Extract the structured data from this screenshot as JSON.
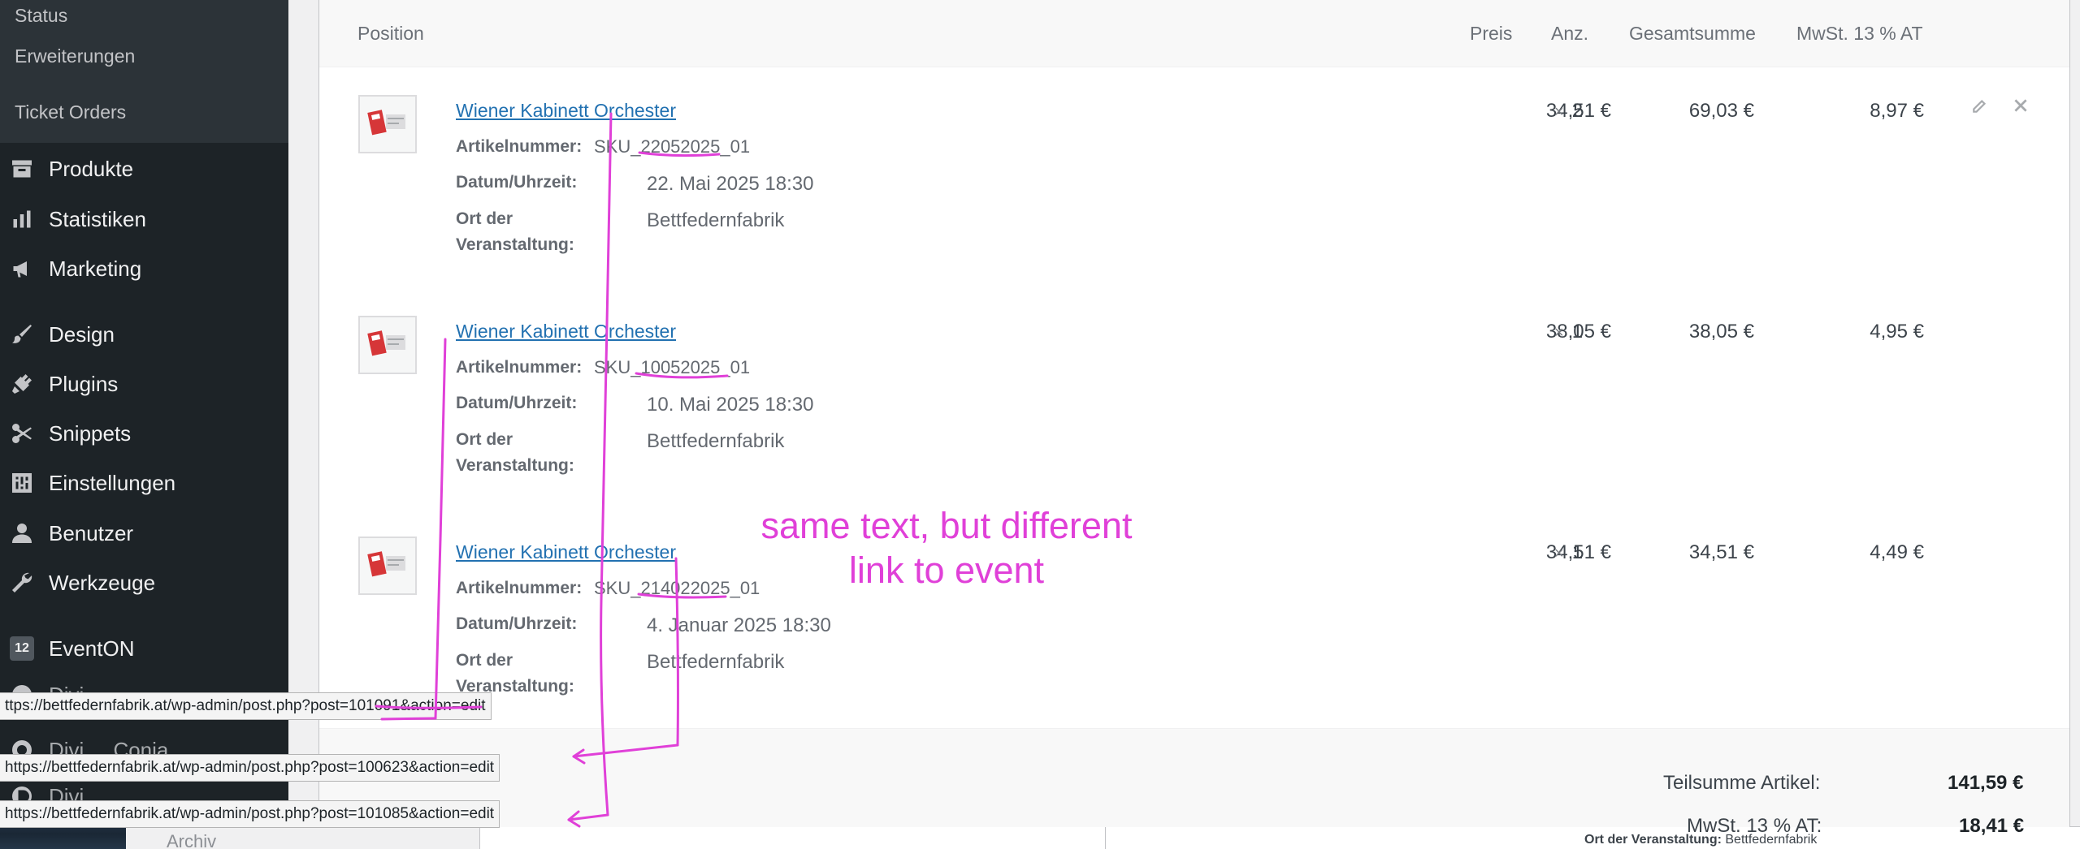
{
  "sidebar": {
    "sub_items": [
      "Status",
      "Erweiterungen",
      "Ticket Orders"
    ],
    "items": [
      {
        "label": "Produkte",
        "icon": "archive-icon"
      },
      {
        "label": "Statistiken",
        "icon": "bar-chart-icon"
      },
      {
        "label": "Marketing",
        "icon": "megaphone-icon"
      },
      {
        "label": "Design",
        "icon": "paintbrush-icon"
      },
      {
        "label": "Plugins",
        "icon": "plug-icon"
      },
      {
        "label": "Snippets",
        "icon": "scissors-icon"
      },
      {
        "label": "Einstellungen",
        "icon": "sliders-icon"
      },
      {
        "label": "Benutzer",
        "icon": "user-icon"
      },
      {
        "label": "Werkzeuge",
        "icon": "wrench-icon"
      },
      {
        "label": "EventON",
        "icon": "calendar-12-icon",
        "badge": "12"
      }
    ],
    "partial_items": [
      "Divi",
      "Divi ... Conia",
      "Divi"
    ]
  },
  "table": {
    "headers": {
      "position": "Position",
      "price": "Preis",
      "qty": "Anz.",
      "total": "Gesamtsumme",
      "tax": "MwSt. 13 % AT"
    },
    "rows": [
      {
        "name": "Wiener Kabinett Orchester",
        "sku_label": "Artikelnummer:",
        "sku": "SKU_22052025_01",
        "date_label": "Datum/Uhrzeit:",
        "date": "22. Mai 2025 18:30",
        "venue_label": "Ort der Veranstaltung:",
        "venue": "Bettfedernfabrik",
        "price": "34,51 €",
        "qty_symbol": "×",
        "qty": "2",
        "total": "69,03 €",
        "tax": "8,97 €"
      },
      {
        "name": "Wiener Kabinett Orchester",
        "sku_label": "Artikelnummer:",
        "sku": "SKU_10052025_01",
        "date_label": "Datum/Uhrzeit:",
        "date": "10. Mai 2025 18:30",
        "venue_label": "Ort der Veranstaltung:",
        "venue": "Bettfedernfabrik",
        "price": "38,05 €",
        "qty_symbol": "×",
        "qty": "1",
        "total": "38,05 €",
        "tax": "4,95 €"
      },
      {
        "name": "Wiener Kabinett Orchester",
        "sku_label": "Artikelnummer:",
        "sku": "SKU_214022025_01",
        "date_label": "Datum/Uhrzeit:",
        "date": "4. Januar 2025 18:30",
        "venue_label": "Ort der Veranstaltung:",
        "venue": "Bettfedernfabrik",
        "price": "34,51 €",
        "qty_symbol": "×",
        "qty": "1",
        "total": "34,51 €",
        "tax": "4,49 €"
      }
    ]
  },
  "totals": {
    "subtotal_label": "Teilsumme Artikel:",
    "subtotal": "141,59 €",
    "tax_label": "MwSt. 13 % AT:",
    "tax": "18,41 €"
  },
  "url_tooltips": [
    "ttps://bettfedernfabrik.at/wp-admin/post.php?post=101091&action=edit",
    "https://bettfedernfabrik.at/wp-admin/post.php?post=100623&action=edit",
    "https://bettfedernfabrik.at/wp-admin/post.php?post=101085&action=edit"
  ],
  "annotation": {
    "line1": "same text, but different",
    "line2": "link to event",
    "color": "#e040d8"
  },
  "background": {
    "archiv_label": "Archiv",
    "detail_label": "Ort der Veranstaltung:",
    "detail_value": "Bettfedernfabrik"
  },
  "colors": {
    "link": "#2271b1",
    "sidebar_bg": "#1d2327",
    "annotation": "#e040d8"
  }
}
